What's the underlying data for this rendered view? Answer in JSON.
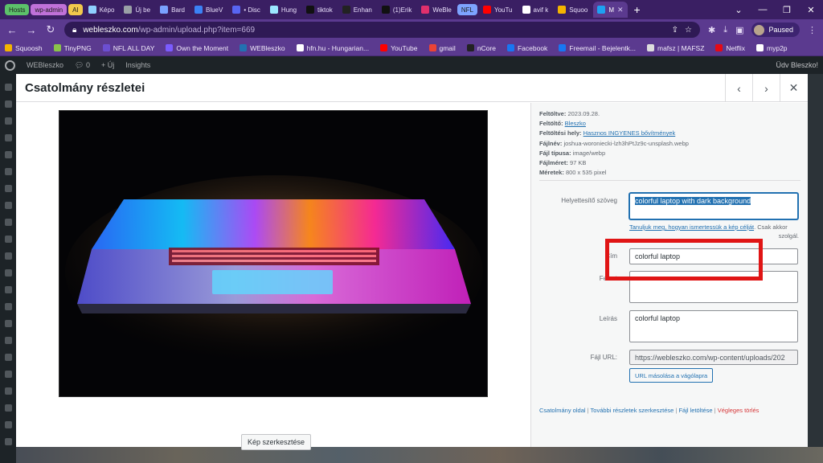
{
  "browser": {
    "tabs": [
      {
        "label": "Hosts",
        "type": "group",
        "color": "#5cc16a"
      },
      {
        "label": "wp-admin",
        "type": "group",
        "color": "#c071d9"
      },
      {
        "label": "AI",
        "type": "group",
        "color": "#f2c94c"
      },
      {
        "label": "Képo",
        "color": "#8fd0ff"
      },
      {
        "label": "Új be",
        "color": "#9aa0a6"
      },
      {
        "label": "Bard",
        "color": "#7aa2ff"
      },
      {
        "label": "BlueV",
        "color": "#3b82f6"
      },
      {
        "label": "• Disc",
        "color": "#5865f2"
      },
      {
        "label": "Hung",
        "color": "#9be7ff"
      },
      {
        "label": "tiktok",
        "color": "#111111"
      },
      {
        "label": "Enhan",
        "color": "#222222"
      },
      {
        "label": "(1)Erik",
        "color": "#111111"
      },
      {
        "label": "WeBle",
        "color": "#e1306c"
      },
      {
        "label": "NFL",
        "type": "group",
        "color": "#7da3ff"
      },
      {
        "label": "YouTu",
        "color": "#ff0000"
      },
      {
        "label": "avif k",
        "color": "#ffffff"
      },
      {
        "label": "Squoo",
        "color": "#f4b400"
      },
      {
        "label": "M",
        "color": "#1da1f2",
        "active": true
      }
    ],
    "new_tab": "+",
    "window_controls": [
      "⌄",
      "—",
      "❐",
      "✕"
    ],
    "url_host": "webleszko.com",
    "url_path": "/wp-admin/upload.php?item=669",
    "profile_status": "Paused",
    "bookmarks": [
      {
        "label": "Squoosh",
        "color": "#f4b400"
      },
      {
        "label": "TinyPNG",
        "color": "#8bc34a"
      },
      {
        "label": "NFL ALL DAY",
        "color": "#6c4fd1"
      },
      {
        "label": "Own the Moment",
        "color": "#7b5cff"
      },
      {
        "label": "WEBleszko",
        "color": "#2271b1"
      },
      {
        "label": "hfn.hu - Hungarian...",
        "color": "#ffffff"
      },
      {
        "label": "YouTube",
        "color": "#ff0000"
      },
      {
        "label": "gmail",
        "color": "#ea4335"
      },
      {
        "label": "nCore",
        "color": "#222222"
      },
      {
        "label": "Facebook",
        "color": "#1877f2"
      },
      {
        "label": "Freemail - Bejelentk...",
        "color": "#1877f2"
      },
      {
        "label": "mafsz | MAFSZ",
        "color": "#dddddd"
      },
      {
        "label": "Netflix",
        "color": "#e50914"
      },
      {
        "label": "myp2p",
        "color": "#ffffff"
      }
    ]
  },
  "wp_admin_bar": {
    "site": "WEBleszko",
    "comments": "0",
    "new": "+ Új",
    "insights": "Insights",
    "greeting": "Üdv Bleszko!"
  },
  "modal": {
    "title": "Csatolmány részletei",
    "prev_icon": "‹",
    "next_icon": "›",
    "close_icon": "✕",
    "edit_image_label": "Kép szerkesztése",
    "meta": {
      "uploaded_label": "Feltöltve:",
      "uploaded_value": "2023.09.28.",
      "uploader_label": "Feltöltő:",
      "uploader_value": "Bleszko",
      "uploaded_to_label": "Feltöltési hely:",
      "uploaded_to_value": "Hasznos INGYENES bővítmények",
      "filename_label": "Fájlnév:",
      "filename_value": "joshua-woroniecki-lzh3hPtJz9c-unsplash.webp",
      "filetype_label": "Fájl típusa:",
      "filetype_value": "image/webp",
      "filesize_label": "Fájlméret:",
      "filesize_value": "97 KB",
      "dimensions_label": "Méretek:",
      "dimensions_value": "800 x 535 pixel"
    },
    "fields": {
      "alt_label": "Helyettesítő szöveg",
      "alt_value": "colorful laptop with dark background",
      "alt_help_link": "Tanuljuk meg, hogyan ismertessük a kép célját",
      "alt_help_text": ". Csak akkor",
      "alt_help_text2": "szolgál.",
      "title_label": "Cím",
      "title_value": "colorful laptop",
      "caption_label": "Felirat",
      "caption_value": "",
      "description_label": "Leírás",
      "description_value": "colorful laptop",
      "file_url_label": "Fájl URL:",
      "file_url_value": "https://webleszko.com/wp-content/uploads/202",
      "copy_url_label": "URL másolása a vágólapra"
    },
    "footer_links": {
      "attachment_page": "Csatolmány oldal",
      "edit_more": "További részletek szerkesztése",
      "download": "Fájl letöltése",
      "delete": "Végleges törlés"
    }
  },
  "annotation": {
    "highlight_color": "#e01515"
  }
}
